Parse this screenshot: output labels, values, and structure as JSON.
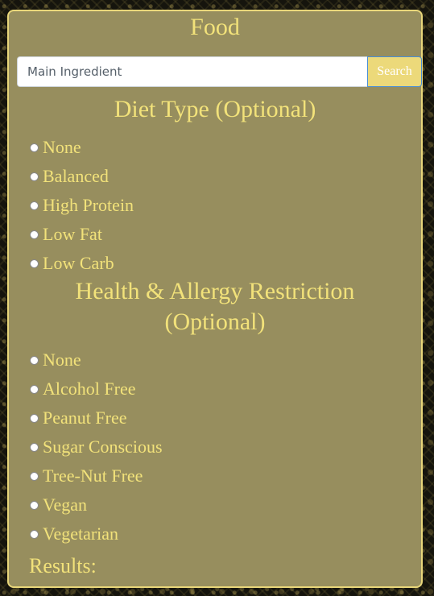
{
  "title": "Food",
  "search": {
    "placeholder": "Main Ingredient",
    "button_label": "Search"
  },
  "diet": {
    "heading": "Diet Type (Optional)",
    "options": [
      "None",
      "Balanced",
      "High Protein",
      "Low Fat",
      "Low Carb"
    ]
  },
  "health": {
    "heading_line1": "Health & Allergy Restriction",
    "heading_line2": "(Optional)",
    "options": [
      "None",
      "Alcohol Free",
      "Peanut Free",
      "Sugar Conscious",
      "Tree-Nut Free",
      "Vegan",
      "Vegetarian"
    ]
  },
  "results_label": "Results:",
  "colors": {
    "panel_bg": "#978e5e",
    "accent_text": "#f2e27a",
    "panel_border": "#e8d67a",
    "button_bg": "#ecd97a"
  }
}
